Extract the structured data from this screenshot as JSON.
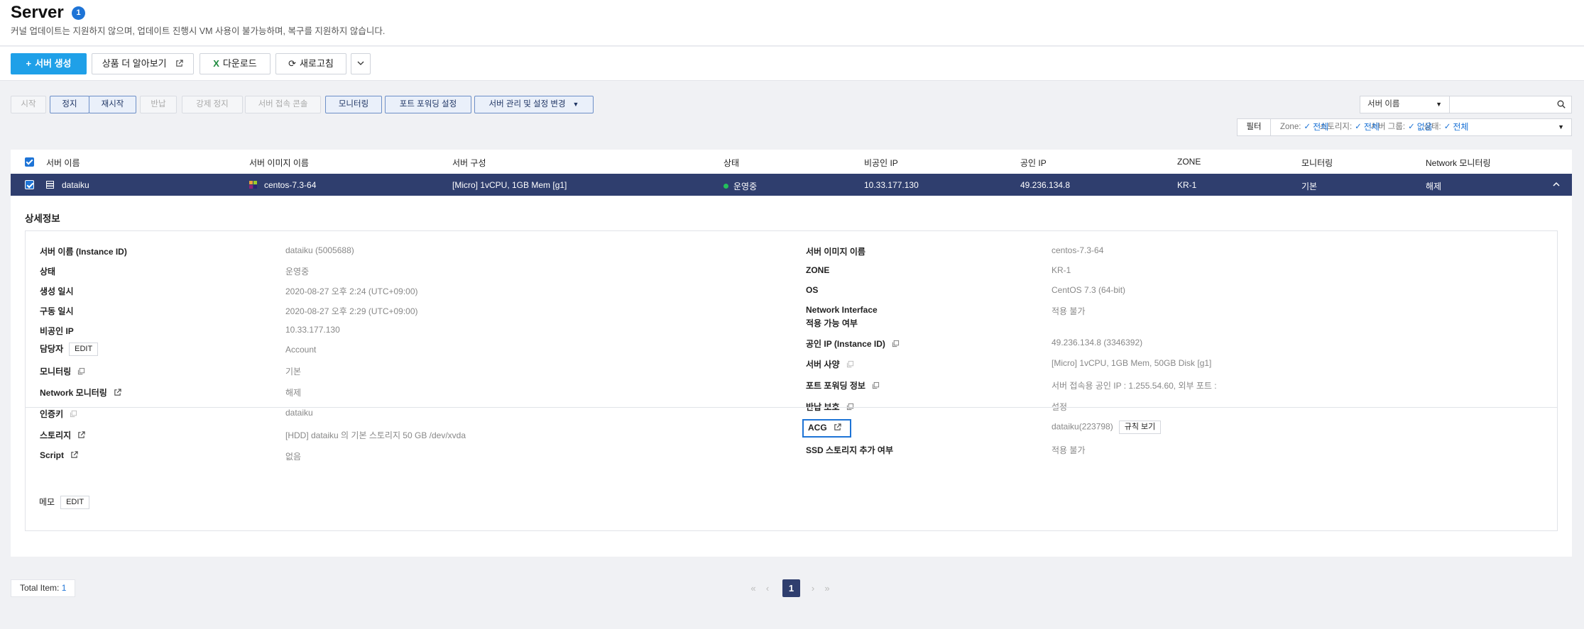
{
  "header": {
    "title": "Server",
    "badge": "1",
    "subtitle": "커널 업데이트는 지원하지 않으며, 업데이트 진행시 VM 사용이 불가능하며, 복구를 지원하지 않습니다."
  },
  "actions": {
    "create": "서버 생성",
    "learn_more": "상품 더 알아보기",
    "download": "다운로드",
    "refresh": "새로고침"
  },
  "toolbar": {
    "start": "시작",
    "stop": "정지",
    "restart": "재시작",
    "return": "반납",
    "force_stop": "강제 정지",
    "console": "서버 접속 콘솔",
    "monitoring": "모니터링",
    "port_forwarding": "포트 포워딩 설정",
    "manage": "서버 관리 및 설정 변경"
  },
  "search": {
    "select_value": "서버 이름",
    "placeholder": ""
  },
  "filter": {
    "button": "필터",
    "zone_label": "Zone:",
    "zone_value": "전체",
    "storage_label": "스토리지:",
    "storage_value": "전체",
    "group_label": "서버 그룹:",
    "group_value": "없음",
    "status_label": "상태:",
    "status_value": "전체"
  },
  "table": {
    "columns": [
      "서버 이름",
      "서버 이미지 이름",
      "서버 구성",
      "상태",
      "비공인 IP",
      "공인 IP",
      "ZONE",
      "모니터링",
      "Network 모니터링"
    ],
    "row": {
      "name": "dataiku",
      "image": "centos-7.3-64",
      "spec": "[Micro] 1vCPU, 1GB Mem [g1]",
      "status": "운영중",
      "private_ip": "10.33.177.130",
      "public_ip": "49.236.134.8",
      "zone": "KR-1",
      "monitoring": "기본",
      "net_monitoring": "해제"
    }
  },
  "detail": {
    "title": "상세정보",
    "left": [
      {
        "label": "서버 이름 (Instance ID)",
        "value": "dataiku (5005688)"
      },
      {
        "label": "상태",
        "value": "운영중"
      },
      {
        "label": "생성 일시",
        "value": "2020-08-27 오후 2:24 (UTC+09:00)"
      },
      {
        "label": "구동 일시",
        "value": "2020-08-27 오후 2:29 (UTC+09:00)"
      },
      {
        "label": "비공인 IP",
        "value": "10.33.177.130"
      },
      {
        "label": "담당자",
        "value": "Account"
      },
      {
        "label": "모니터링",
        "value": "기본"
      },
      {
        "label": "Network 모니터링",
        "value": "해제"
      },
      {
        "label": "인증키",
        "value": "dataiku"
      },
      {
        "label": "스토리지",
        "value": "[HDD] dataiku 의 기본 스토리지  50 GB /dev/xvda"
      },
      {
        "label": "Script",
        "value": "없음"
      }
    ],
    "right": [
      {
        "label": "서버 이미지 이름",
        "value": "centos-7.3-64"
      },
      {
        "label": "ZONE",
        "value": "KR-1"
      },
      {
        "label": "OS",
        "value": "CentOS 7.3 (64-bit)"
      },
      {
        "label": "Network Interface",
        "label2": "적용 가능 여부",
        "value": "적용 불가"
      },
      {
        "label": "공인 IP (Instance ID)",
        "value": "49.236.134.8 (3346392)"
      },
      {
        "label": "서버 사양",
        "value": "[Micro] 1vCPU, 1GB Mem, 50GB Disk [g1]"
      },
      {
        "label": "포트 포워딩 정보",
        "value": "서버 접속용 공인 IP : 1.255.54.60, 외부 포트 :"
      },
      {
        "label": "반납 보호",
        "value": "설정"
      },
      {
        "label": "ACG",
        "value": "dataiku(223798)"
      },
      {
        "label": "SSD 스토리지 추가 여부",
        "value": "적용 불가"
      }
    ],
    "edit": "EDIT",
    "rules_button": "규칙 보기",
    "memo_label": "메모"
  },
  "footer": {
    "total_label": "Total Item:",
    "total_value": "1",
    "page": "1"
  },
  "colors": {
    "primary": "#1fa0e8",
    "navy": "#2f3e6e",
    "link": "#1e74d6"
  }
}
